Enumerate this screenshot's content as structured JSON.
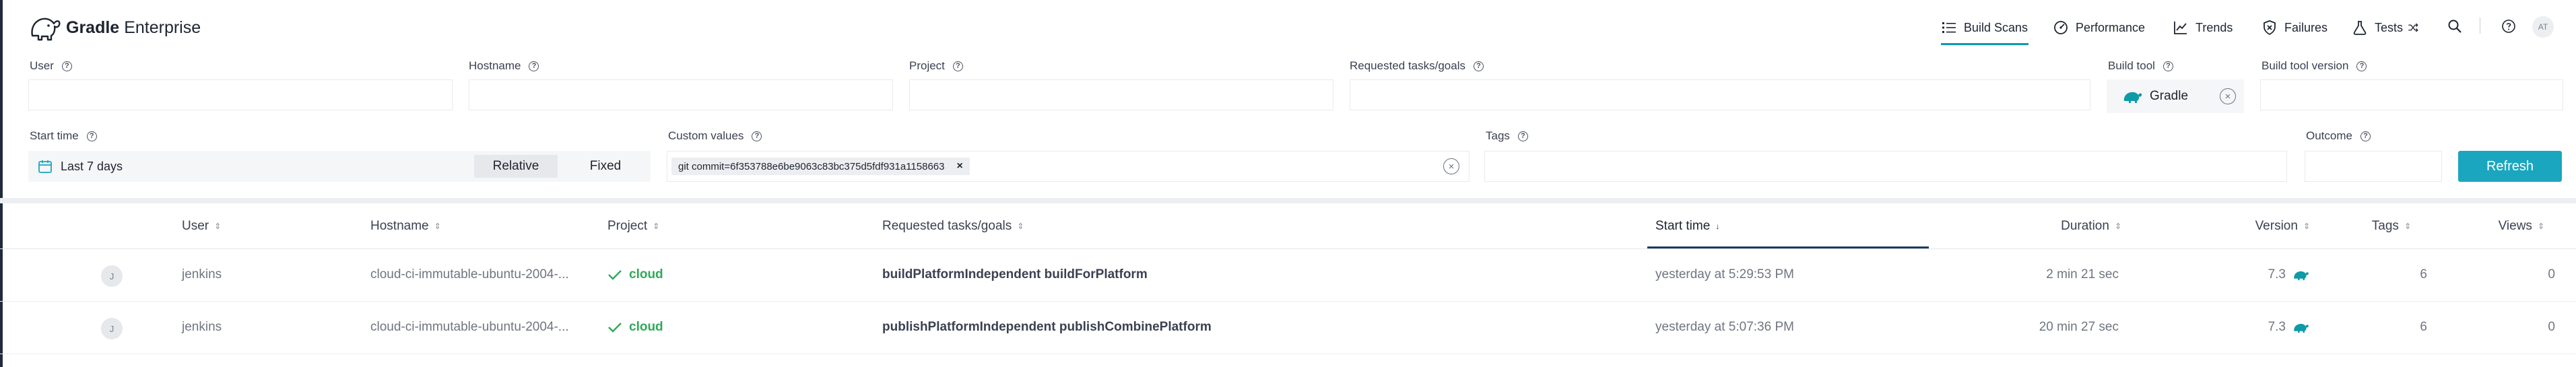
{
  "app": {
    "brand_bold": "Gradle",
    "brand_light": "Enterprise"
  },
  "nav": {
    "build_scans": "Build Scans",
    "performance": "Performance",
    "trends": "Trends",
    "failures": "Failures",
    "tests": "Tests",
    "user_initials": "AT"
  },
  "filters": {
    "user": {
      "label": "User",
      "value": ""
    },
    "hostname": {
      "label": "Hostname",
      "value": ""
    },
    "project": {
      "label": "Project",
      "value": ""
    },
    "requested_tasks": {
      "label": "Requested tasks/goals",
      "value": ""
    },
    "build_tool": {
      "label": "Build tool",
      "value": "Gradle"
    },
    "build_tool_version": {
      "label": "Build tool version",
      "value": ""
    },
    "start_time": {
      "label": "Start time",
      "value": "Last 7 days",
      "relative": "Relative",
      "fixed": "Fixed",
      "selected": "Relative"
    },
    "custom_values": {
      "label": "Custom values",
      "chip": "git commit=6f353788e6be9063c83bc375d5fdf931a1158663"
    },
    "tags": {
      "label": "Tags",
      "value": ""
    },
    "outcome": {
      "label": "Outcome",
      "value": ""
    },
    "refresh_label": "Refresh"
  },
  "table": {
    "columns": {
      "user": "User",
      "hostname": "Hostname",
      "project": "Project",
      "requested": "Requested tasks/goals",
      "start_time": "Start time",
      "duration": "Duration",
      "version": "Version",
      "tags": "Tags",
      "views": "Views"
    },
    "sorted_column": "start_time",
    "rows": [
      {
        "initial": "J",
        "user": "jenkins",
        "hostname": "cloud-ci-immutable-ubuntu-2004-...",
        "project": "cloud",
        "status": "success",
        "tasks": "buildPlatformIndependent buildForPlatform",
        "start_time": "yesterday at 5:29:53 PM",
        "duration": "2 min 21 sec",
        "version": "7.3",
        "tags": "6",
        "views": "0"
      },
      {
        "initial": "J",
        "user": "jenkins",
        "hostname": "cloud-ci-immutable-ubuntu-2004-...",
        "project": "cloud",
        "status": "success",
        "tasks": "publishPlatformIndependent publishCombinePlatform",
        "start_time": "yesterday at 5:07:36 PM",
        "duration": "20 min 27 sec",
        "version": "7.3",
        "tags": "6",
        "views": "0"
      }
    ]
  },
  "colors": {
    "accent": "#1aa6be",
    "success": "#2eaa58",
    "sorted": "#1e3a5f"
  }
}
